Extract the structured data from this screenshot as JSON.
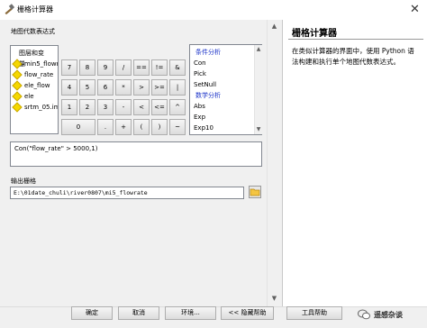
{
  "window": {
    "title": "栅格计算器",
    "close": "✕"
  },
  "expression_label": "地图代数表达式",
  "layers": {
    "header": "图层和变量",
    "items": [
      "min5_flowrate",
      "flow_rate",
      "ele_flow",
      "ele",
      "srtm_05.img"
    ]
  },
  "calc_buttons": [
    "7",
    "8",
    "9",
    "/",
    "==",
    "!=",
    "&",
    "4",
    "5",
    "6",
    "*",
    ">",
    ">=",
    "|",
    "1",
    "2",
    "3",
    "-",
    "<",
    "<=",
    "^",
    "0",
    ".",
    "+",
    "(",
    ")",
    "~"
  ],
  "tools": {
    "items": [
      {
        "text": "条件分析",
        "header": true
      },
      {
        "text": "Con",
        "header": false
      },
      {
        "text": "Pick",
        "header": false
      },
      {
        "text": "SetNull",
        "header": false
      },
      {
        "text": "数学分析",
        "header": true
      },
      {
        "text": "Abs",
        "header": false
      },
      {
        "text": "Exp",
        "header": false
      },
      {
        "text": "Exp10",
        "header": false
      }
    ]
  },
  "expression": "Con(\"flow_rate\" > 5000,1)",
  "output": {
    "label": "输出栅格",
    "value": "E:\\01date_chuli\\river0807\\mi5_flowrate"
  },
  "help": {
    "title": "栅格计算器",
    "body": "在类似计算器的界面中，使用 Python 语法构建和执行单个地图代数表达式。"
  },
  "buttons": {
    "ok": "确定",
    "cancel": "取消",
    "env": "环境...",
    "hide_help": "<< 隐藏帮助",
    "tool_help": "工具帮助"
  },
  "watermark": "遥感杂谈"
}
